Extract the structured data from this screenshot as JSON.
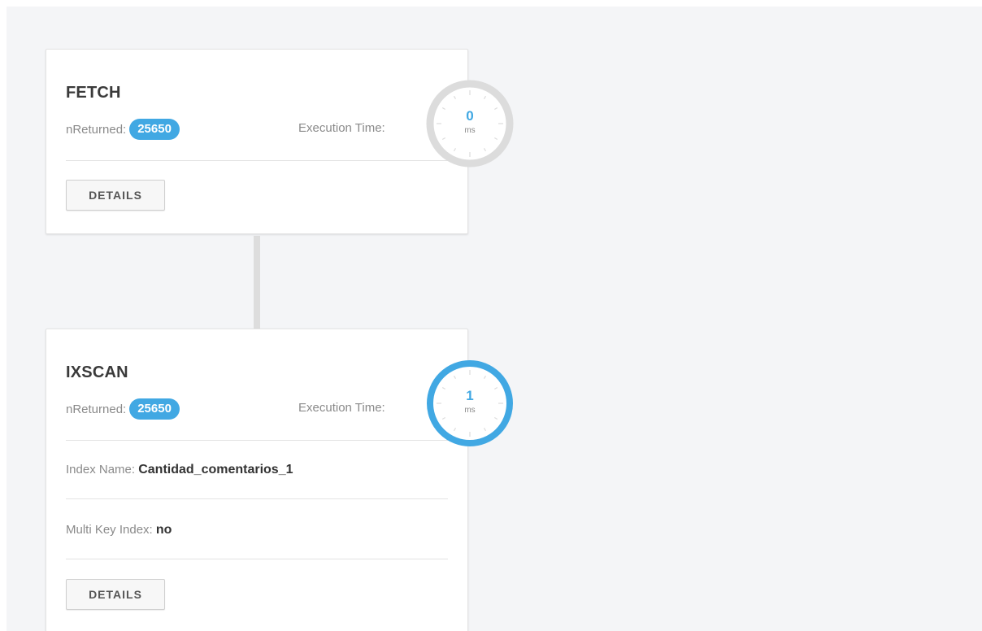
{
  "colors": {
    "accent": "#41a8e3",
    "clock_idle_ring": "#dcdcdc",
    "canvas_bg": "#f4f5f7",
    "connector": "#dddddd"
  },
  "stages": [
    {
      "title": "FETCH",
      "n_returned_label": "nReturned:",
      "n_returned": "25650",
      "exec_time_label": "Execution Time:",
      "exec_time_ms": "0",
      "exec_time_unit": "ms",
      "details_label": "DETAILS"
    },
    {
      "title": "IXSCAN",
      "n_returned_label": "nReturned:",
      "n_returned": "25650",
      "exec_time_label": "Execution Time:",
      "exec_time_ms": "1",
      "exec_time_unit": "ms",
      "index_name_label": "Index Name:",
      "index_name": "Cantidad_comentarios_1",
      "multi_key_label": "Multi Key Index:",
      "multi_key": "no",
      "details_label": "DETAILS"
    }
  ]
}
